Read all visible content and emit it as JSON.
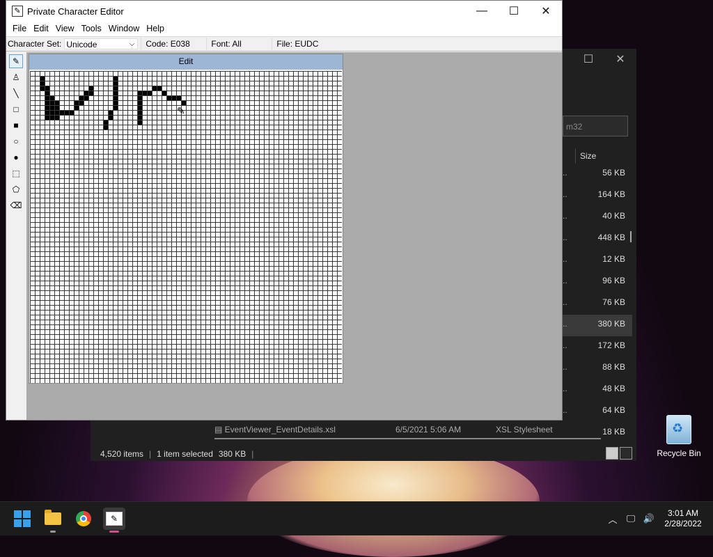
{
  "explorer": {
    "search_partial": "m32",
    "size_header": "Size",
    "rows": [
      {
        "trunc": "..",
        "size": "56 KB"
      },
      {
        "trunc": "..",
        "size": "164 KB"
      },
      {
        "trunc": "..",
        "size": "40 KB"
      },
      {
        "trunc": "..",
        "size": "448 KB"
      },
      {
        "trunc": "..",
        "size": "12 KB"
      },
      {
        "trunc": "..",
        "size": "96 KB"
      },
      {
        "trunc": "..",
        "size": "76 KB"
      },
      {
        "trunc": "..",
        "size": "380 KB"
      },
      {
        "trunc": "..",
        "size": "172 KB"
      },
      {
        "trunc": "..",
        "size": "88 KB"
      },
      {
        "trunc": "..",
        "size": "48 KB"
      },
      {
        "trunc": "..",
        "size": "64 KB"
      },
      {
        "trunc": "",
        "size": "18 KB"
      }
    ],
    "bottom_row": {
      "name": "EventViewer_EventDetails.xsl",
      "date": "6/5/2021 5:06 AM",
      "type": "XSL Stylesheet"
    },
    "status": {
      "items": "4,520 items",
      "selected": "1 item selected",
      "size": "380 KB"
    }
  },
  "pce": {
    "title": "Private Character Editor",
    "menu": [
      "File",
      "Edit",
      "View",
      "Tools",
      "Window",
      "Help"
    ],
    "charset_label": "Character Set:",
    "charset_value": "Unicode",
    "code": "Code: E038",
    "font": "Font: All",
    "file": "File: EUDC",
    "edit_caption": "Edit"
  },
  "desktop": {
    "recycle_bin": "Recycle Bin"
  },
  "taskbar": {
    "time": "3:01 AM",
    "date": "2/28/2022"
  }
}
